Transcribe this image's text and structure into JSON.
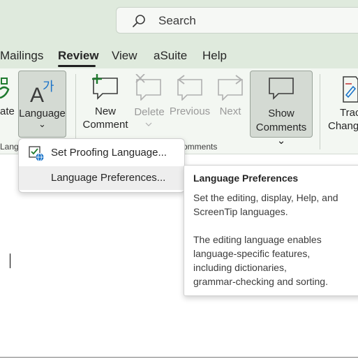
{
  "search": {
    "placeholder": "Search"
  },
  "tabs": [
    {
      "label": "Mailings"
    },
    {
      "label": "Review"
    },
    {
      "label": "View"
    },
    {
      "label": "aSuite"
    },
    {
      "label": "Help"
    }
  ],
  "ribbon": {
    "translate_partial": "ate",
    "language_label": "Language",
    "language_chevron": "⌄",
    "language_group_partial": "Lang",
    "new_comment_line1": "New",
    "new_comment_line2": "Comment",
    "delete_label": "Delete",
    "previous_label": "Previous",
    "next_label": "Next",
    "show_comments_line1": "Show",
    "show_comments_line2": "Comments ⌄",
    "comments_group_partial": "omments",
    "track_line1": "Trac",
    "track_line2": "Chang"
  },
  "language_menu": {
    "items": [
      {
        "label": "Set Proofing Language..."
      },
      {
        "label": "Language Preferences..."
      }
    ]
  },
  "tooltip": {
    "title": "Language Preferences",
    "paragraph1_line1": "Set the editing, display, Help, and",
    "paragraph1_line2": "ScreenTip languages.",
    "paragraph2_line1": "The editing language enables",
    "paragraph2_line2": "language-specific features,",
    "paragraph2_line3": "including dictionaries,",
    "paragraph2_line4": "grammar-checking and sorting."
  },
  "colors": {
    "accent_blue": "#1a73c9",
    "accent_green": "#1e7a2e",
    "chrome_bg": "#dfeadd"
  }
}
